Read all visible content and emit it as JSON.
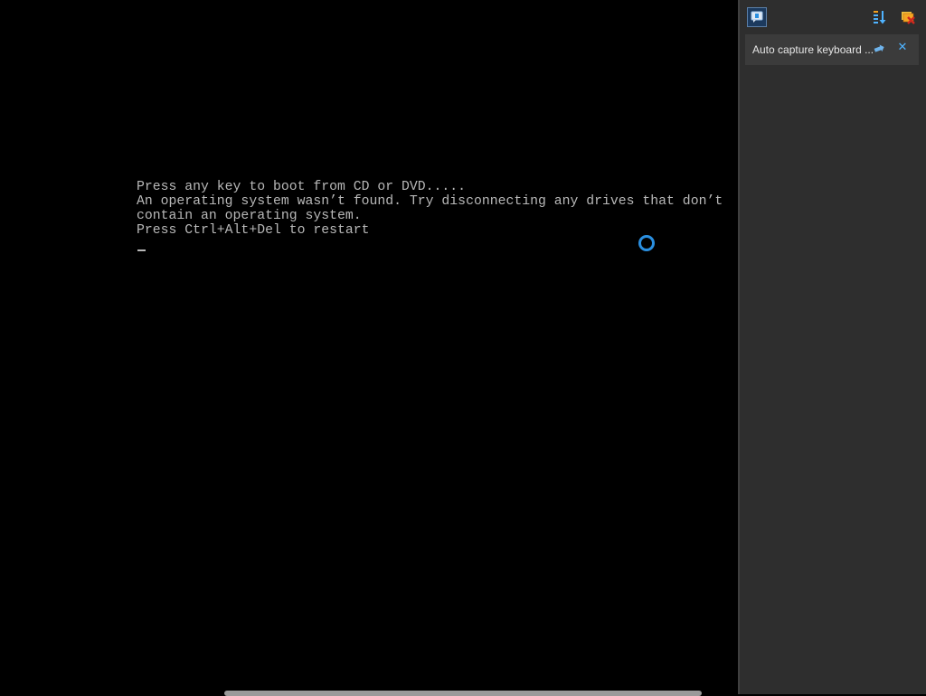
{
  "console": {
    "lines": [
      "Press any key to boot from CD or DVD.....",
      "An operating system wasn’t found. Try disconnecting any drives that don’t",
      "contain an operating system.",
      "Press Ctrl+Alt+Del to restart"
    ],
    "text_color": "#b8b8b8",
    "background": "#000000"
  },
  "busy_indicator": {
    "icon": "loading-ring-icon",
    "color": "#2a8fe0"
  },
  "side_panel": {
    "toolbar": {
      "chat_icon": "chat-bubble-icon",
      "sort_icon": "sort-icon",
      "close_all_icon": "close-all-icon"
    },
    "notification": {
      "text": "Auto capture keyboard ...",
      "pin_icon": "pin-icon",
      "close_icon": "close-icon",
      "close_glyph": "✕",
      "accent": "#4fb3ff"
    },
    "background": "#2e2e2e"
  }
}
